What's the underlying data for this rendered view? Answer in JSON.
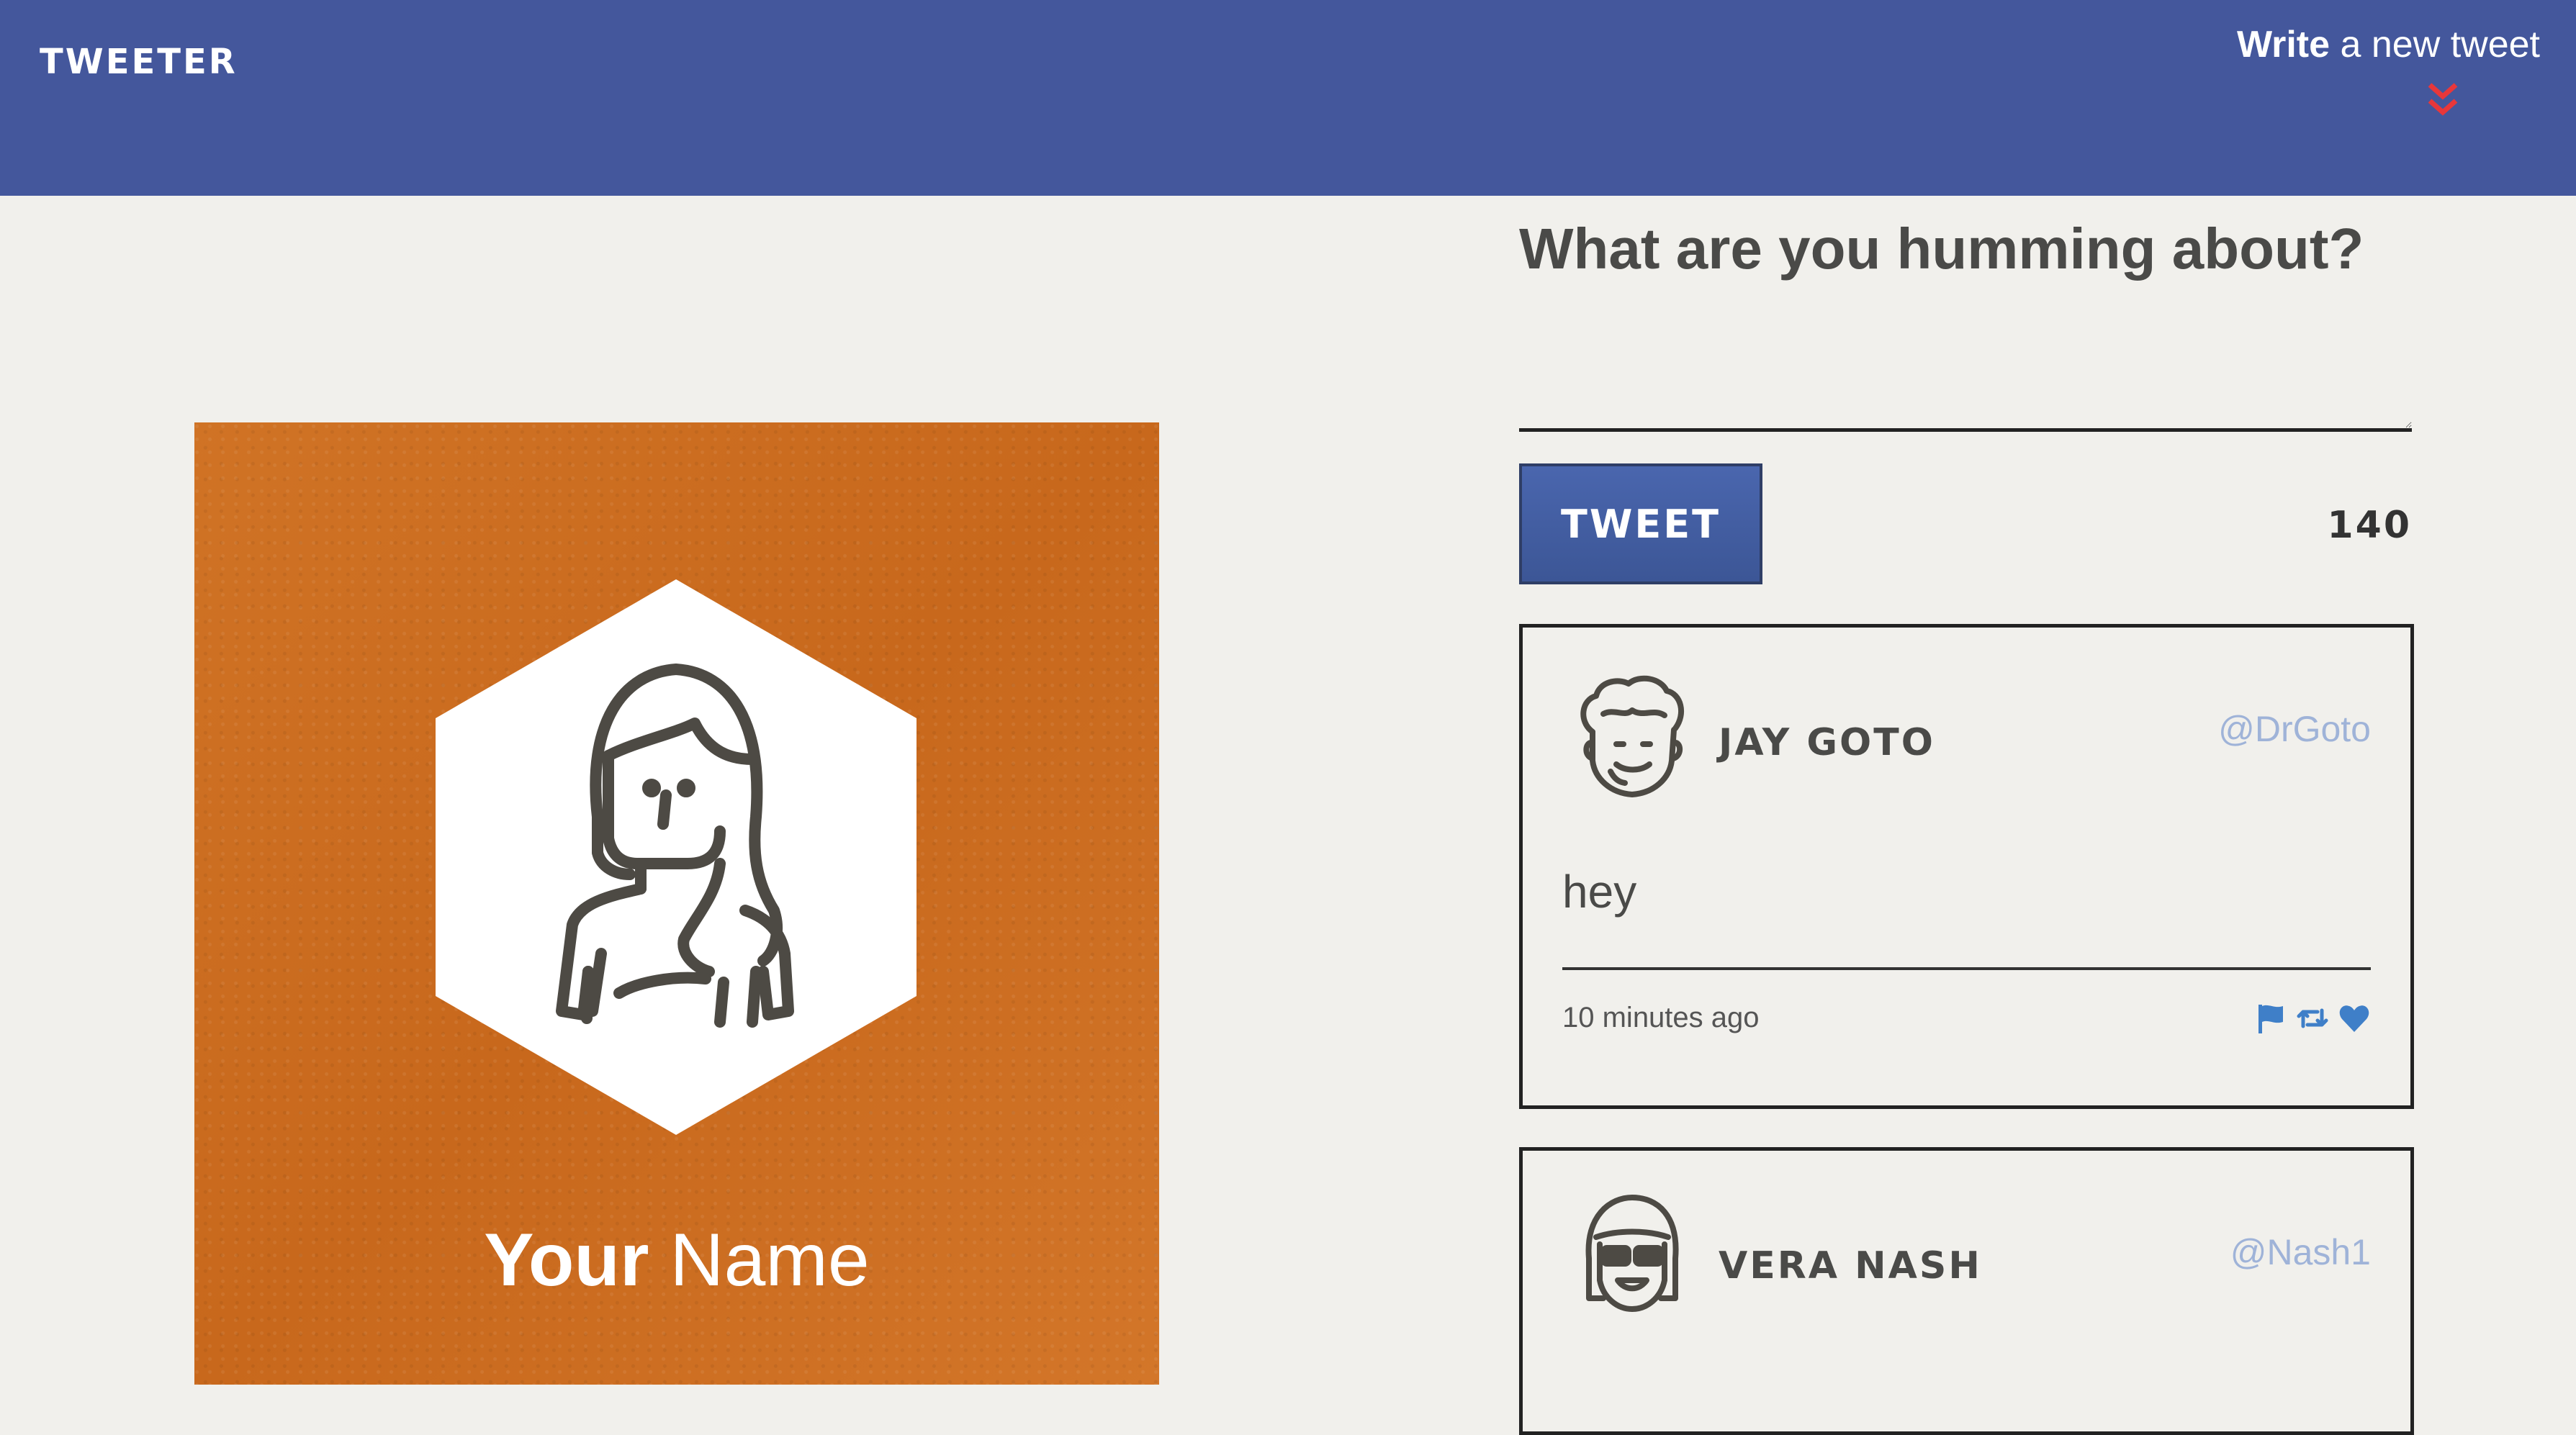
{
  "navbar": {
    "brand": "TWEETER",
    "write_strong": "Write",
    "write_rest": " a new tweet",
    "chevron_icon": "double-chevron-down-icon",
    "background_color": "#44579c",
    "chevron_color": "#e8373a"
  },
  "profile": {
    "first_name": "Your",
    "last_name": " Name",
    "avatar_icon": "woman-avatar-icon",
    "background_color": "#cd6d21"
  },
  "compose": {
    "title": "What are you humming about?",
    "textarea_value": "",
    "button_label": "TWEET",
    "counter": "140"
  },
  "tweets": [
    {
      "display_name": "JAY GOTO",
      "handle": "@DrGoto",
      "text": "hey",
      "timestamp": "10 minutes ago",
      "avatar_icon": "curly-hair-man-avatar-icon",
      "actions": [
        "flag-icon",
        "retweet-icon",
        "heart-icon"
      ]
    },
    {
      "display_name": "VERA NASH",
      "handle": "@Nash1",
      "avatar_icon": "sunglasses-avatar-icon"
    }
  ],
  "colors": {
    "action_icons": "#3f7fc8",
    "handle": "#9fb3d8"
  }
}
